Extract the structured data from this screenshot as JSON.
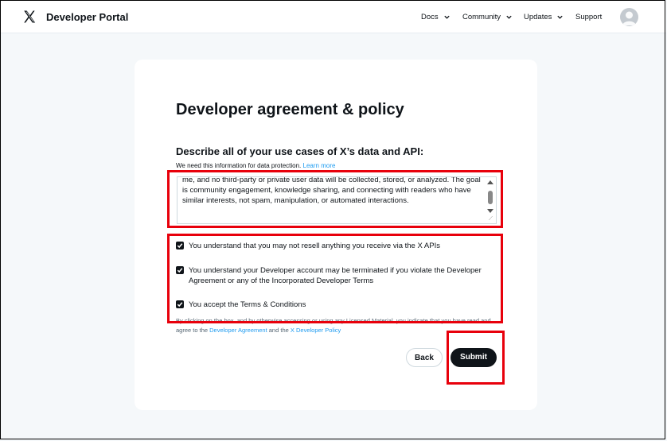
{
  "header": {
    "brand": "Developer Portal",
    "nav": [
      {
        "label": "Docs",
        "has_dropdown": true
      },
      {
        "label": "Community",
        "has_dropdown": true
      },
      {
        "label": "Updates",
        "has_dropdown": true
      },
      {
        "label": "Support",
        "has_dropdown": false
      }
    ]
  },
  "form": {
    "title": "Developer agreement & policy",
    "question": "Describe all of your use cases of X’s data and API:",
    "hint": "We need this information for data protection.",
    "learn_more": "Learn more",
    "use_case_text": "me, and no third-party or private user data will be collected, stored, or analyzed. The goal is community engagement, knowledge sharing, and connecting with readers who have similar interests, not spam, manipulation, or automated interactions.",
    "checkboxes": [
      {
        "label": "You understand that you may not resell anything you receive via the X APIs",
        "checked": true
      },
      {
        "label": "You understand your Developer account may be terminated if you violate the Developer Agreement or any of the Incorporated Developer Terms",
        "checked": true
      },
      {
        "label": "You accept the Terms & Conditions",
        "checked": true
      }
    ],
    "legal_prefix": "By clicking on the box, and by otherwise accessing or using any Licensed Material, you indicate that you have read and agree to the",
    "legal_link1": "Developer Agreement",
    "legal_and": "and the",
    "legal_link2": "X Developer Policy",
    "back_label": "Back",
    "submit_label": "Submit"
  },
  "colors": {
    "accent": "#1d9bf0",
    "highlight": "#e8000b",
    "primary_button": "#0f1419"
  }
}
